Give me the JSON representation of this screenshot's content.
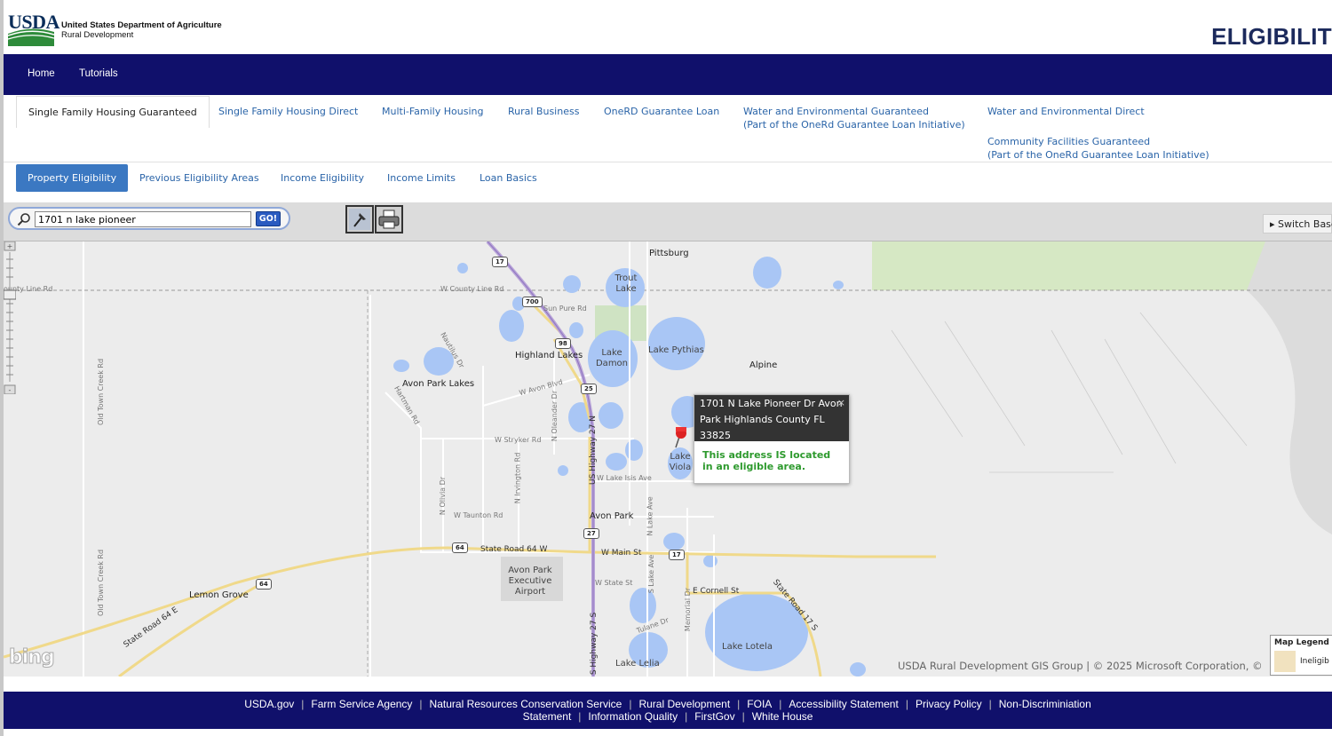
{
  "header": {
    "logo_text": "USDA",
    "agency_name": "United States Department of Agriculture",
    "agency_sub": "Rural Development",
    "page_title": "ELIGIBILIT"
  },
  "main_nav": {
    "home": "Home",
    "tutorials": "Tutorials"
  },
  "program_tabs": {
    "sfh_guaranteed": "Single Family Housing Guaranteed",
    "sfh_direct": "Single Family Housing Direct",
    "multi_family": "Multi-Family Housing",
    "rural_business": "Rural Business",
    "onerd": "OneRD Guarantee Loan",
    "water_guaranteed": "Water and Environmental Guaranteed",
    "water_guaranteed_note": "(Part of the OneRd Guarantee Loan Initiative)",
    "water_direct": "Water and Environmental Direct",
    "community_guaranteed": "Community Facilities Guaranteed",
    "community_guaranteed_note": "(Part of the OneRd Guarantee Loan Initiative)"
  },
  "sub_tabs": {
    "property": "Property Eligibility",
    "previous": "Previous Eligibility Areas",
    "income": "Income Eligibility",
    "limits": "Income Limits",
    "basics": "Loan Basics"
  },
  "search": {
    "value": "1701 n lake pioneer",
    "go_label": "GO!"
  },
  "toolbar": {
    "switch_label": "Switch Base"
  },
  "map": {
    "places": {
      "pittsburg": "Pittsburg",
      "trout_lake": "Trout Lake",
      "highland_lakes": "Highland Lakes",
      "lake_damon": "Lake Damon",
      "lake_pythias": "Lake Pythias",
      "alpine": "Alpine",
      "avon_park_lakes": "Avon Park Lakes",
      "lake_viola": "Lake Viola",
      "avon_park": "Avon Park",
      "airport": "Avon Park Executive Airport",
      "lemon_grove": "Lemon Grove",
      "lake_lotela": "Lake Lotela",
      "lake_lelia": "Lake Lelia"
    },
    "roads": {
      "county_line": "W County Line Rd",
      "county_line_left": "ounty Line Rd",
      "sun_pure": "Sun Pure Rd",
      "nautilus": "Nautilus Dr",
      "avon_blvd": "W Avon Blvd",
      "hartman": "Hartman Rd",
      "stryker": "W Stryker Rd",
      "oleander": "N Oleander Dr",
      "irvington": "N Irvington Rd",
      "olivia": "N Olivia Dr",
      "taunton": "W Taunton Rd",
      "us27": "US Highway 27 N",
      "us27s": "S Highway 27 S",
      "sr64": "State Road 64 W",
      "sr64e": "State Road 64 E",
      "main_st": "W Main St",
      "state_st": "W State St",
      "cornell": "E Cornell St",
      "sr17": "State Road 17 S",
      "old_town": "Old Town Creek Rd",
      "old_town2": "Old Town Creek Rd",
      "lake_isis": "W Lake Isis Ave",
      "lake_ave": "N Lake Ave",
      "memorial": "Memorial Dr",
      "lake_ave_s": "S Lake Ave",
      "tulane": "Tulane Dr"
    },
    "shields": {
      "s17a": "17",
      "s700": "700",
      "s98": "98",
      "s25": "25",
      "s27": "27",
      "s64a": "64",
      "s64b": "64",
      "s17b": "17"
    },
    "popup": {
      "address_line1": "1701 N Lake Pioneer Dr Avon",
      "address_line2": "Park Highlands County FL",
      "address_line3": "33825",
      "result": "This address IS located in an eligible area.",
      "close": "×"
    },
    "bing": "bing",
    "attribution": "USDA Rural Development GIS Group | © 2025 Microsoft Corporation, ©",
    "legend": {
      "title": "Map Legend",
      "item": "Ineligib",
      "item_color": "#f1e2bf"
    }
  },
  "footer": {
    "row1": [
      "USDA.gov",
      "Farm Service Agency",
      "Natural Resources Conservation Service",
      "Rural Development",
      "FOIA",
      "Accessibility Statement",
      "Privacy Policy",
      "Non-Discriminiation"
    ],
    "row2": [
      "Statement",
      "Information Quality",
      "FirstGov",
      "White House"
    ]
  }
}
